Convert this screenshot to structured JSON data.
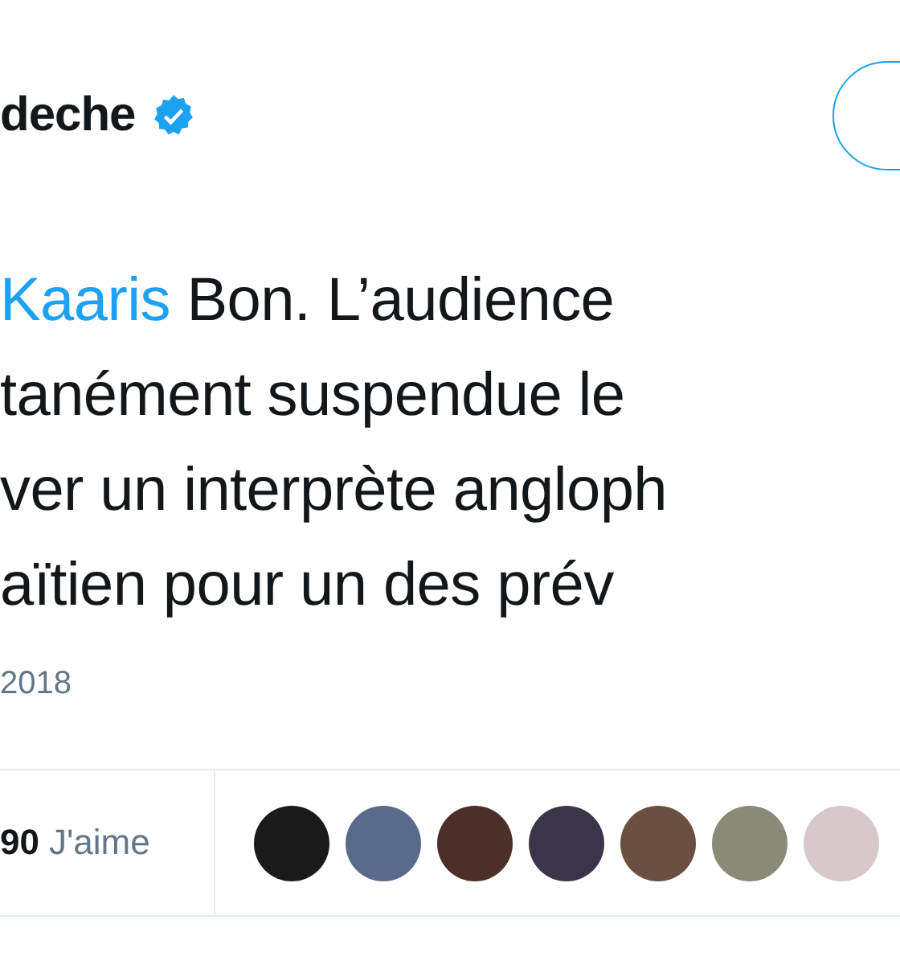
{
  "author": {
    "name": "deche"
  },
  "tweet": {
    "lines": [
      {
        "mention": "Kaaris",
        "text": "Bon. L’audience"
      },
      {
        "text": "tanément suspendue le"
      },
      {
        "text": "ver un interprète angloph"
      },
      {
        "text": "aïtien pour un des prév"
      }
    ]
  },
  "date": "2018",
  "stats": {
    "count": "90",
    "label": "J'aime"
  }
}
